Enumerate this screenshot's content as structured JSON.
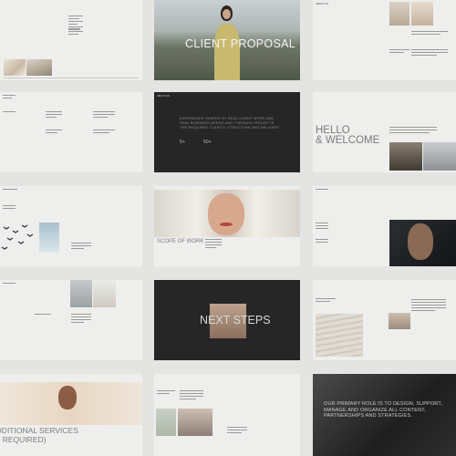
{
  "slides": {
    "proposal": {
      "title": "CLIENT PROPOSAL"
    },
    "hello": {
      "line1": "HELLO",
      "line2": "& WELCOME"
    },
    "dark_intro": {
      "text": "EXPERIENCE SHAPED BY REAL CLIENT WORK AND REAL BUSINESS NEEDS AND THROUGH PROJECTS THE REQUIRED CLARITY, STRUCTURE AND DELIVERY.",
      "stat1": "5+",
      "stat2": "50+"
    },
    "scope": {
      "title": "SCOPE OF WORK"
    },
    "next": {
      "title": "NEXT STEPS"
    },
    "additional": {
      "line1": "ADDITIONAL SERVICES",
      "line2": "(IF REQUIRED)"
    },
    "closing": {
      "text": "OUR PRIMARY ROLE IS TO DESIGN, SUPPORT, MANAGE AND ORGANIZE ALL CONTENT, PARTNERSHIPS AND STRATEGIES."
    }
  },
  "colors": {
    "slide_bg": "#eeeeec",
    "dark_slide_bg": "#262626",
    "page_bg": "#e4e4e2",
    "title_gray": "#7c7c7c"
  }
}
